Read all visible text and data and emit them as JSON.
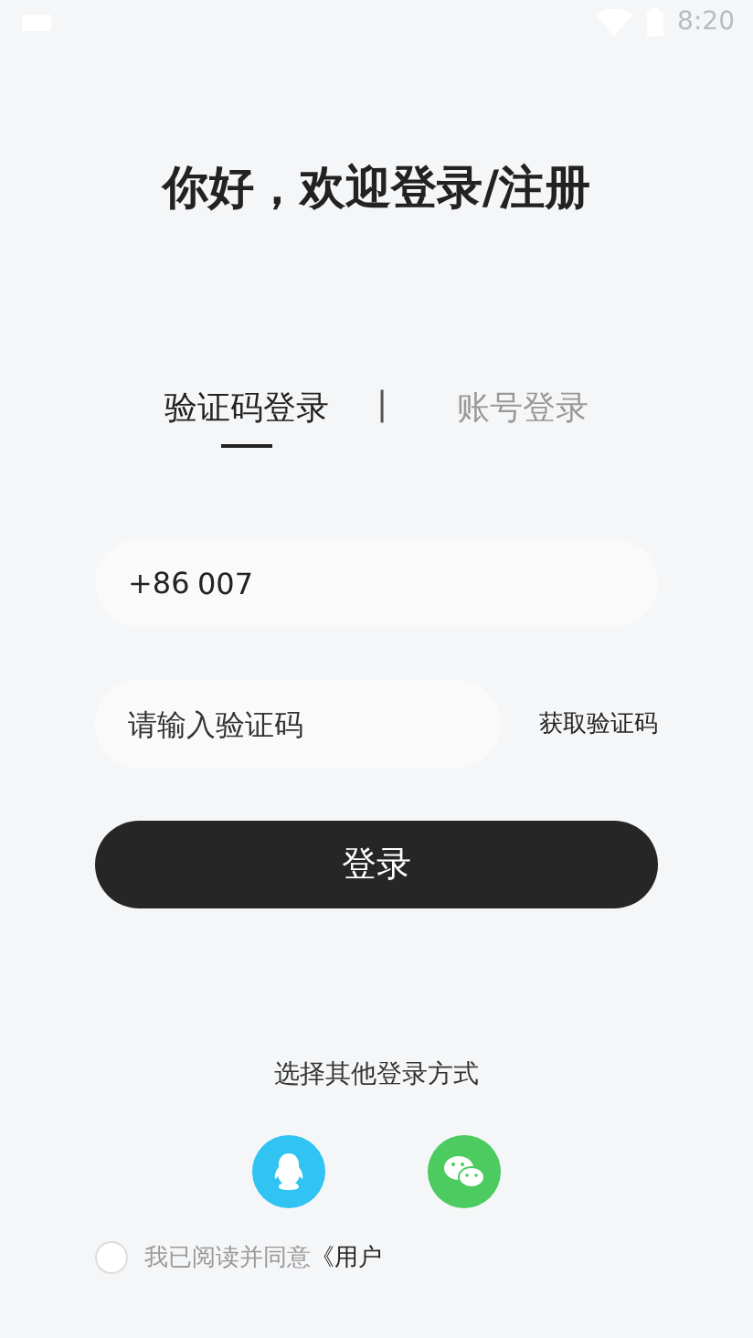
{
  "status_bar": {
    "time": "8:20"
  },
  "title": "你好，欢迎登录/注册",
  "tabs": [
    {
      "label": "验证码登录",
      "selected": true
    },
    {
      "label": "账号登录",
      "selected": false
    }
  ],
  "tab_separator": "|",
  "phone_field": {
    "country_code": "+86",
    "value": "007"
  },
  "code_field": {
    "placeholder": "请输入验证码"
  },
  "get_code_button": "获取验证码",
  "login_button": "登录",
  "other_methods": {
    "label": "选择其他登录方式",
    "options": [
      {
        "kind": "qq",
        "color": "#31c3f2"
      },
      {
        "kind": "wechat",
        "color": "#4ccb60"
      }
    ]
  },
  "agreement": {
    "checked": false,
    "text": "我已阅读并同意",
    "link": "《用户"
  }
}
